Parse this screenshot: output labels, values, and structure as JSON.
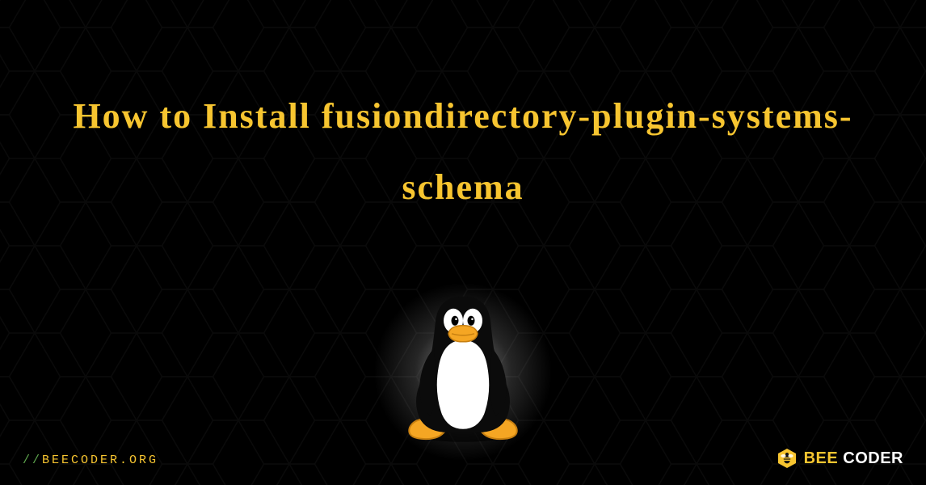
{
  "title": "How to Install fusiondirectory-plugin-systems-schema",
  "footer": {
    "slashes": "//",
    "site": "BEECODER.ORG"
  },
  "brand": {
    "word1": "BEE",
    "word2": "CODER"
  },
  "colors": {
    "accent": "#f7c530",
    "green": "#5fa84e",
    "bg": "#000000"
  },
  "icons": {
    "mascot": "tux-penguin-icon",
    "brand": "bee-hex-icon"
  }
}
